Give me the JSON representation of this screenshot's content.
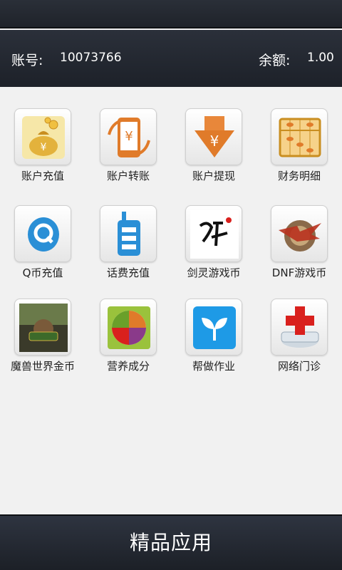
{
  "header": {
    "account_label": "账号:",
    "account_value": "10073766",
    "balance_label": "余额:",
    "balance_value": "1.00"
  },
  "tiles": [
    {
      "label": "账户充值",
      "icon": "money-bags-icon"
    },
    {
      "label": "账户转账",
      "icon": "phone-transfer-icon"
    },
    {
      "label": "账户提现",
      "icon": "withdraw-arrow-icon"
    },
    {
      "label": "财务明细",
      "icon": "abacus-icon"
    },
    {
      "label": "Q币充值",
      "icon": "qq-icon"
    },
    {
      "label": "话费充值",
      "icon": "mobile-phone-icon"
    },
    {
      "label": "剑灵游戏币",
      "icon": "blade-soul-icon"
    },
    {
      "label": "DNF游戏币",
      "icon": "dnf-icon"
    },
    {
      "label": "魔兽世界金币",
      "icon": "world-of-warcraft-icon"
    },
    {
      "label": "营养成分",
      "icon": "nutrition-plate-icon"
    },
    {
      "label": "帮做作业",
      "icon": "homework-leaf-icon"
    },
    {
      "label": "网络门诊",
      "icon": "red-cross-icon"
    }
  ],
  "bottom": {
    "title": "精品应用"
  },
  "colors": {
    "header_bg": "#262b33",
    "grid_bg": "#f1f1f1",
    "accent_orange": "#e07b2a",
    "accent_blue": "#2a8fd6",
    "cross_red": "#d9201d"
  }
}
